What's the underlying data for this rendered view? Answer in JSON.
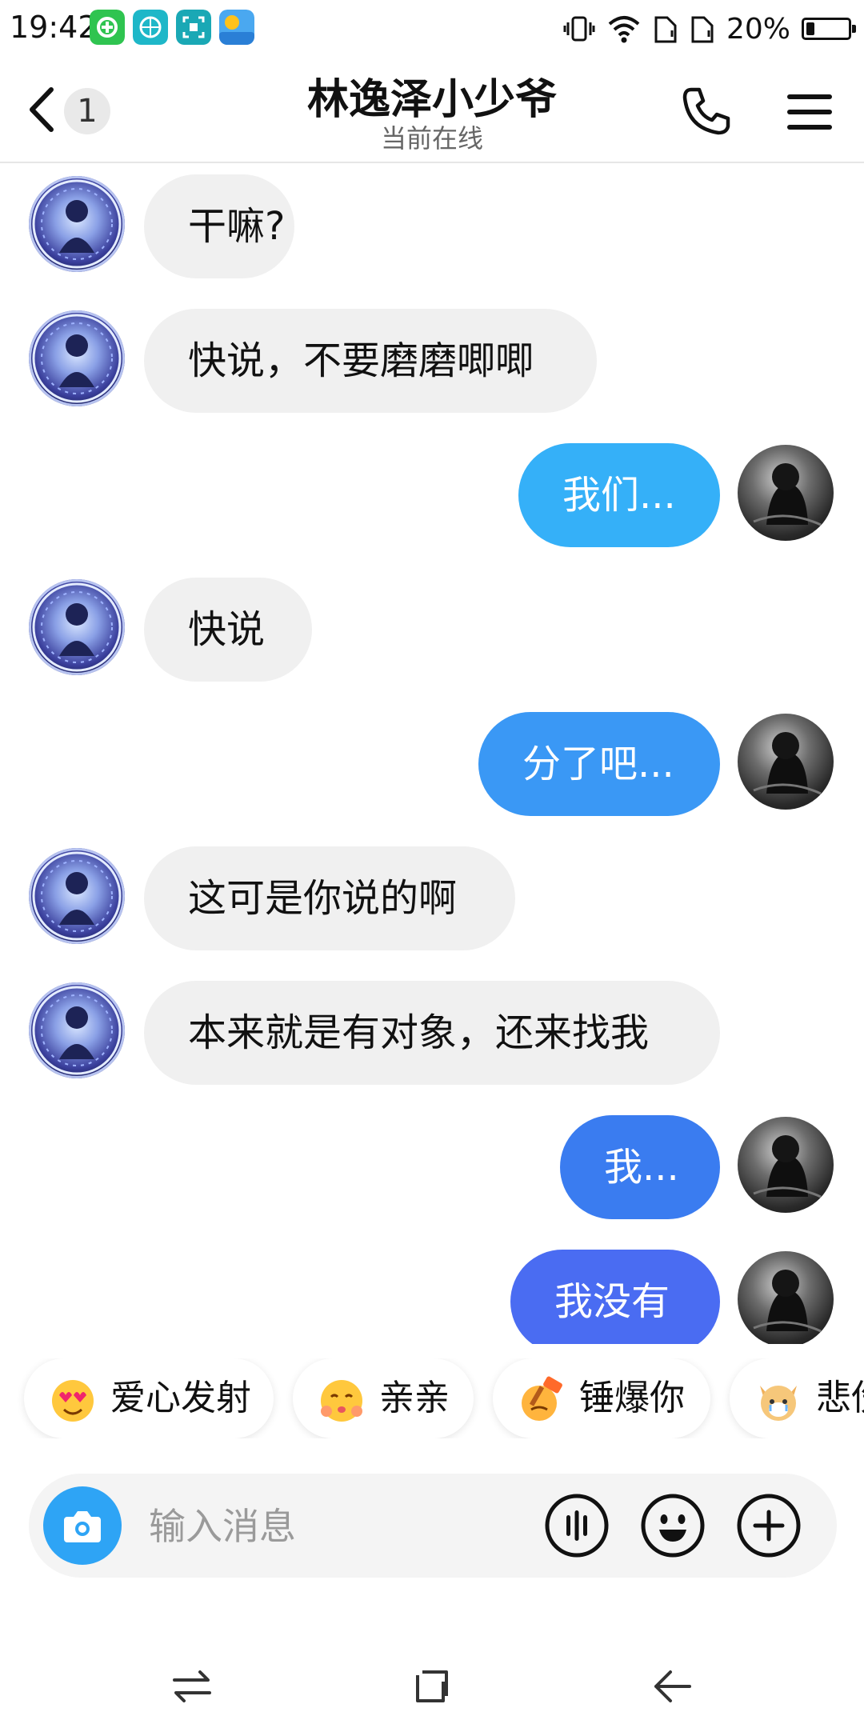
{
  "status_bar": {
    "time": "19:42",
    "battery_text": "20%",
    "battery_level": 0.2
  },
  "header": {
    "unread_count": "1",
    "title": "林逸泽小少爷",
    "subtitle": "当前在线"
  },
  "messages": [
    {
      "sender": "them",
      "text": "干嘛?"
    },
    {
      "sender": "them",
      "text": "快说，不要磨磨唧唧"
    },
    {
      "sender": "me",
      "text": "我们...",
      "color": "#35b0f8"
    },
    {
      "sender": "them",
      "text": "快说"
    },
    {
      "sender": "me",
      "text": "分了吧...",
      "color": "#3a98f5"
    },
    {
      "sender": "them",
      "text": "这可是你说的啊"
    },
    {
      "sender": "them",
      "text": "本来就是有对象，还来找我"
    },
    {
      "sender": "me",
      "text": "我...",
      "color": "#3a7cf0"
    },
    {
      "sender": "me",
      "text": "我没有",
      "color": "#4a6cf2"
    }
  ],
  "quick_reactions": [
    {
      "label": "爱心发射",
      "icon": "heart-eyes-emoji-icon"
    },
    {
      "label": "亲亲",
      "icon": "kiss-emoji-icon"
    },
    {
      "label": "锤爆你",
      "icon": "hammer-emoji-icon"
    },
    {
      "label": "悲伤",
      "icon": "sad-dog-emoji-icon"
    }
  ],
  "input": {
    "placeholder": "输入消息"
  },
  "colors": {
    "accent": "#2ea4f5",
    "bubble_them": "#f0f0f0"
  }
}
